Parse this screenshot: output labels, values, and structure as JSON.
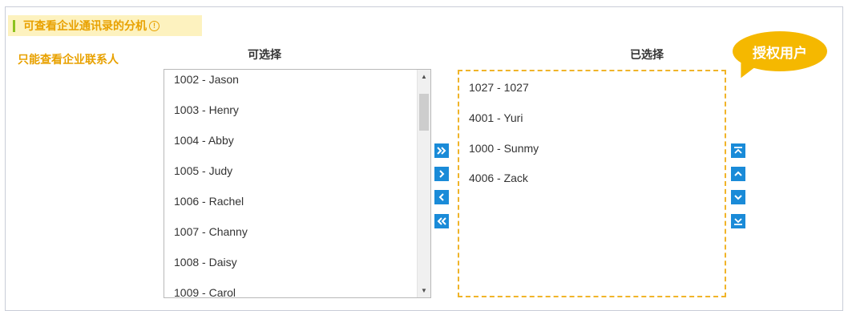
{
  "section": {
    "title": "可查看企业通讯录的分机",
    "info_icon": "info-icon"
  },
  "side_label": "只能查看企业联系人",
  "available": {
    "header": "可选择",
    "items": [
      "1002 - Jason",
      "1003 - Henry",
      "1004 - Abby",
      "1005 - Judy",
      "1006 - Rachel",
      "1007 - Channy",
      "1008 - Daisy",
      "1009 - Carol"
    ]
  },
  "selected": {
    "header": "已选择",
    "items": [
      "1027 - 1027",
      "4001 - Yuri",
      "1000 - Sunmy",
      "4006 - Zack"
    ]
  },
  "tooltip": {
    "text": "授权用户"
  },
  "transfer_buttons": [
    "add-all-icon",
    "add-icon",
    "remove-icon",
    "remove-all-icon"
  ],
  "order_buttons": [
    "move-top-icon",
    "move-up-icon",
    "move-down-icon",
    "move-bottom-icon"
  ],
  "colors": {
    "accent_orange": "#e8a100",
    "title_bg": "#fdf2bf",
    "title_bar": "#8dc21f",
    "button_blue": "#1a8bd8",
    "tooltip_bg": "#f5b800",
    "selected_border": "#f0b429"
  }
}
